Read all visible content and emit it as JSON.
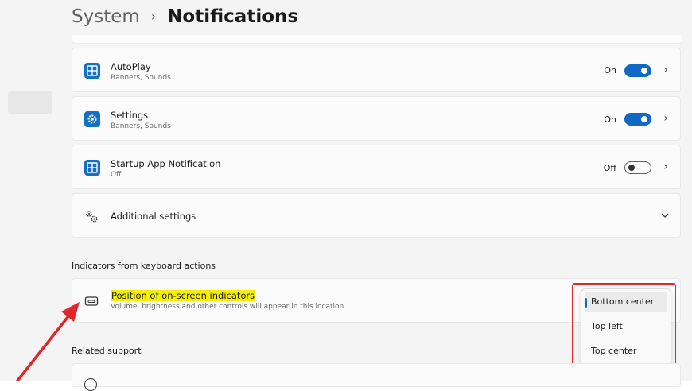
{
  "breadcrumb": {
    "parent": "System",
    "separator": "›",
    "current": "Notifications"
  },
  "notifications": [
    {
      "title": "AutoPlay",
      "subtitle": "Banners, Sounds",
      "state": "On",
      "enabled": true,
      "icon": "autoplay-icon"
    },
    {
      "title": "Settings",
      "subtitle": "Banners, Sounds",
      "state": "On",
      "enabled": true,
      "icon": "settings-gear-icon"
    },
    {
      "title": "Startup App Notification",
      "subtitle": "Off",
      "state": "Off",
      "enabled": false,
      "icon": "startup-app-icon"
    }
  ],
  "additional_settings": {
    "label": "Additional settings",
    "icon": "gears-icon"
  },
  "indicators_section": {
    "title": "Indicators from keyboard actions",
    "setting_title": "Position of on-screen indicators",
    "setting_desc": "Volume, brightness and other controls will appear in this location",
    "icon": "screen-indicator-icon"
  },
  "dropdown": {
    "options": [
      "Bottom center",
      "Top left",
      "Top center"
    ],
    "selected": "Bottom center"
  },
  "related_support": {
    "title": "Related support"
  },
  "colors": {
    "accent": "#1168c5",
    "highlight": "#f6f000",
    "annotation_red": "#e0252b"
  }
}
